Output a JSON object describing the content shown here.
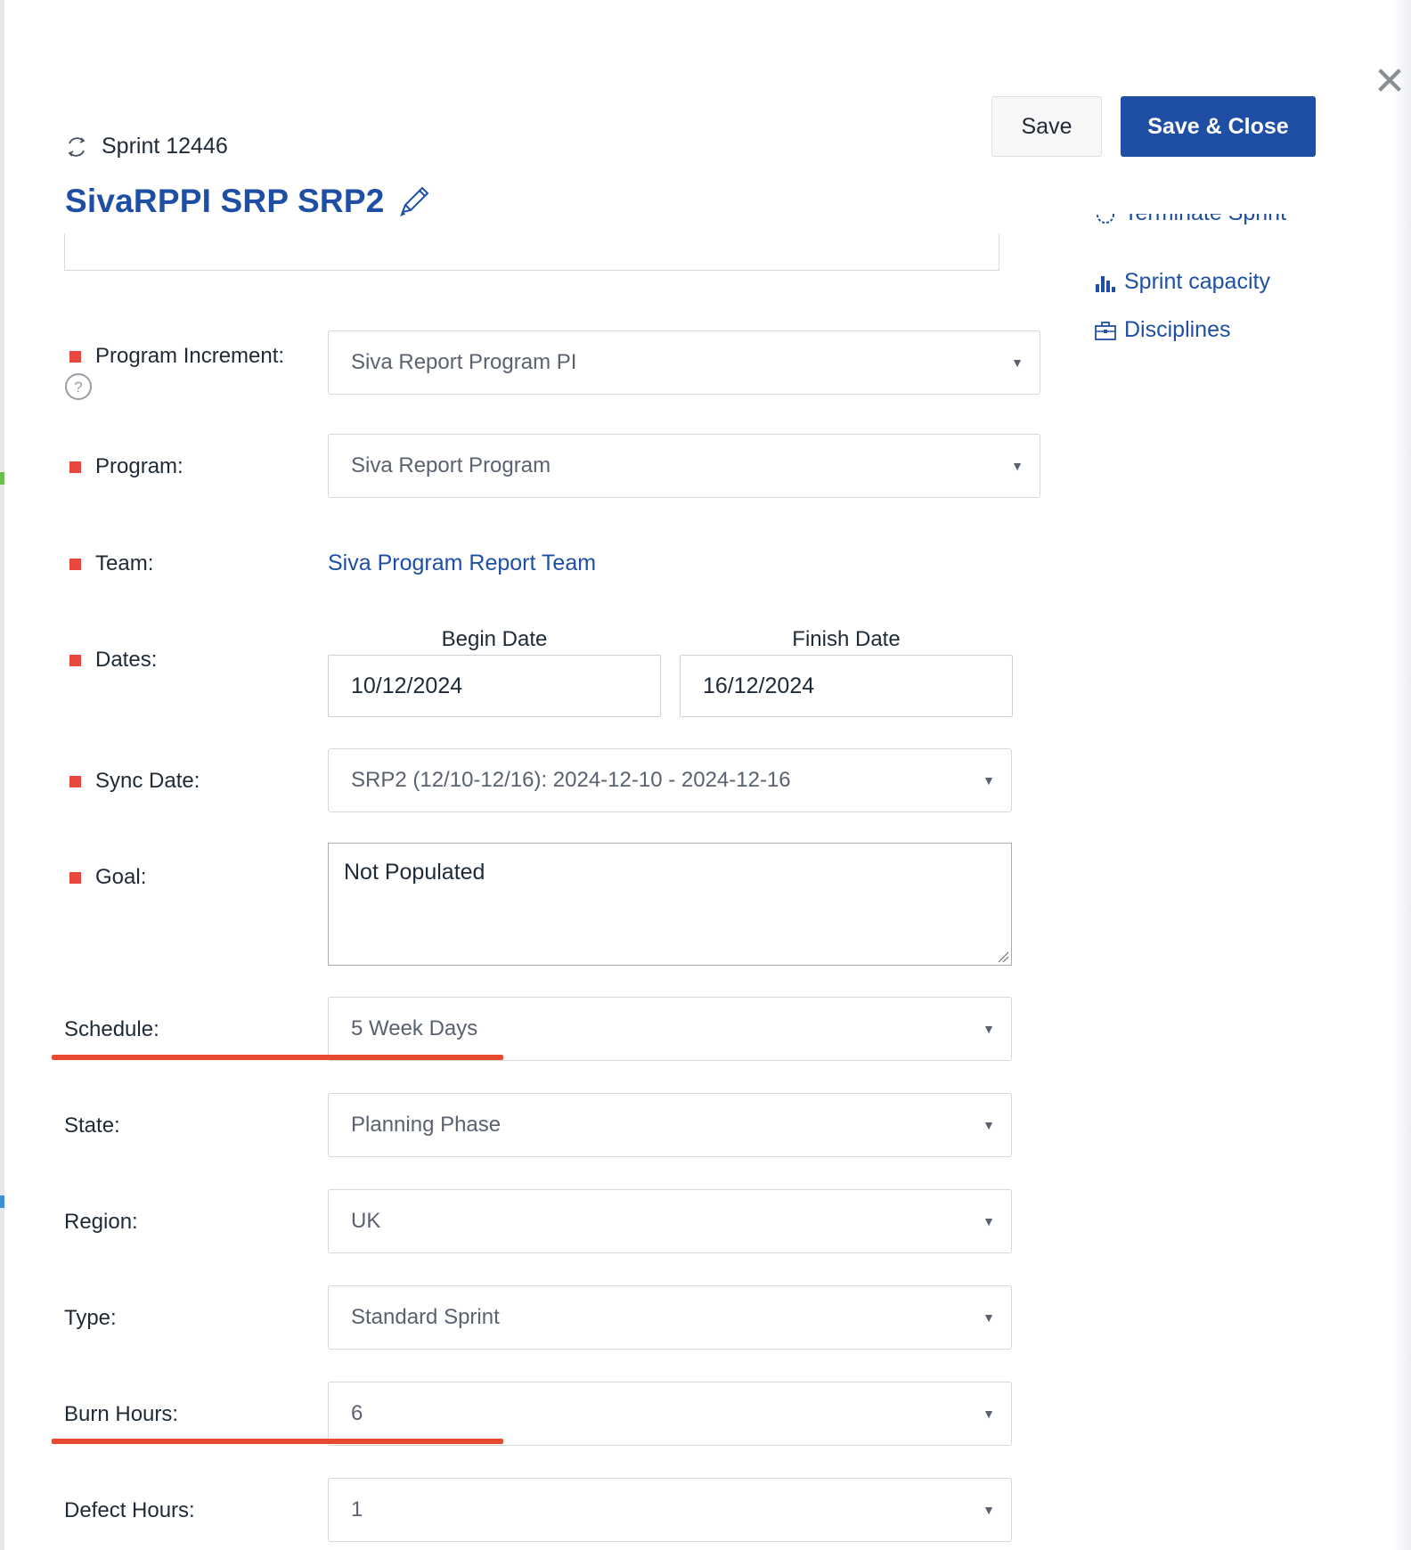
{
  "header": {
    "sprint_label": "Sprint 12446",
    "title": "SivaRPPI SRP SRP2"
  },
  "toolbar": {
    "save_label": "Save",
    "save_close_label": "Save & Close"
  },
  "side_links": {
    "terminate": "Terminate Sprint",
    "capacity": "Sprint capacity",
    "disciplines": "Disciplines"
  },
  "form": {
    "program_increment": {
      "label": "Program Increment:",
      "value": "Siva Report Program PI"
    },
    "program": {
      "label": "Program:",
      "value": "Siva Report Program"
    },
    "team": {
      "label": "Team:",
      "value": "Siva Program Report Team"
    },
    "dates": {
      "label": "Dates:",
      "begin_header": "Begin Date",
      "finish_header": "Finish Date",
      "begin_value": "10/12/2024",
      "finish_value": "16/12/2024"
    },
    "sync_date": {
      "label": "Sync Date:",
      "value": "SRP2 (12/10-12/16): 2024-12-10 - 2024-12-16"
    },
    "goal": {
      "label": "Goal:",
      "value": "Not Populated"
    },
    "schedule": {
      "label": "Schedule:",
      "value": "5 Week Days"
    },
    "state": {
      "label": "State:",
      "value": "Planning Phase"
    },
    "region": {
      "label": "Region:",
      "value": "UK"
    },
    "type": {
      "label": "Type:",
      "value": "Standard Sprint"
    },
    "burn_hours": {
      "label": "Burn Hours:",
      "value": "6"
    },
    "defect_hours": {
      "label": "Defect Hours:",
      "value": "1"
    }
  },
  "colors": {
    "accent": "#1e4fa5",
    "required_marker": "#e8473d",
    "annotation_underline": "#e84a2f"
  }
}
